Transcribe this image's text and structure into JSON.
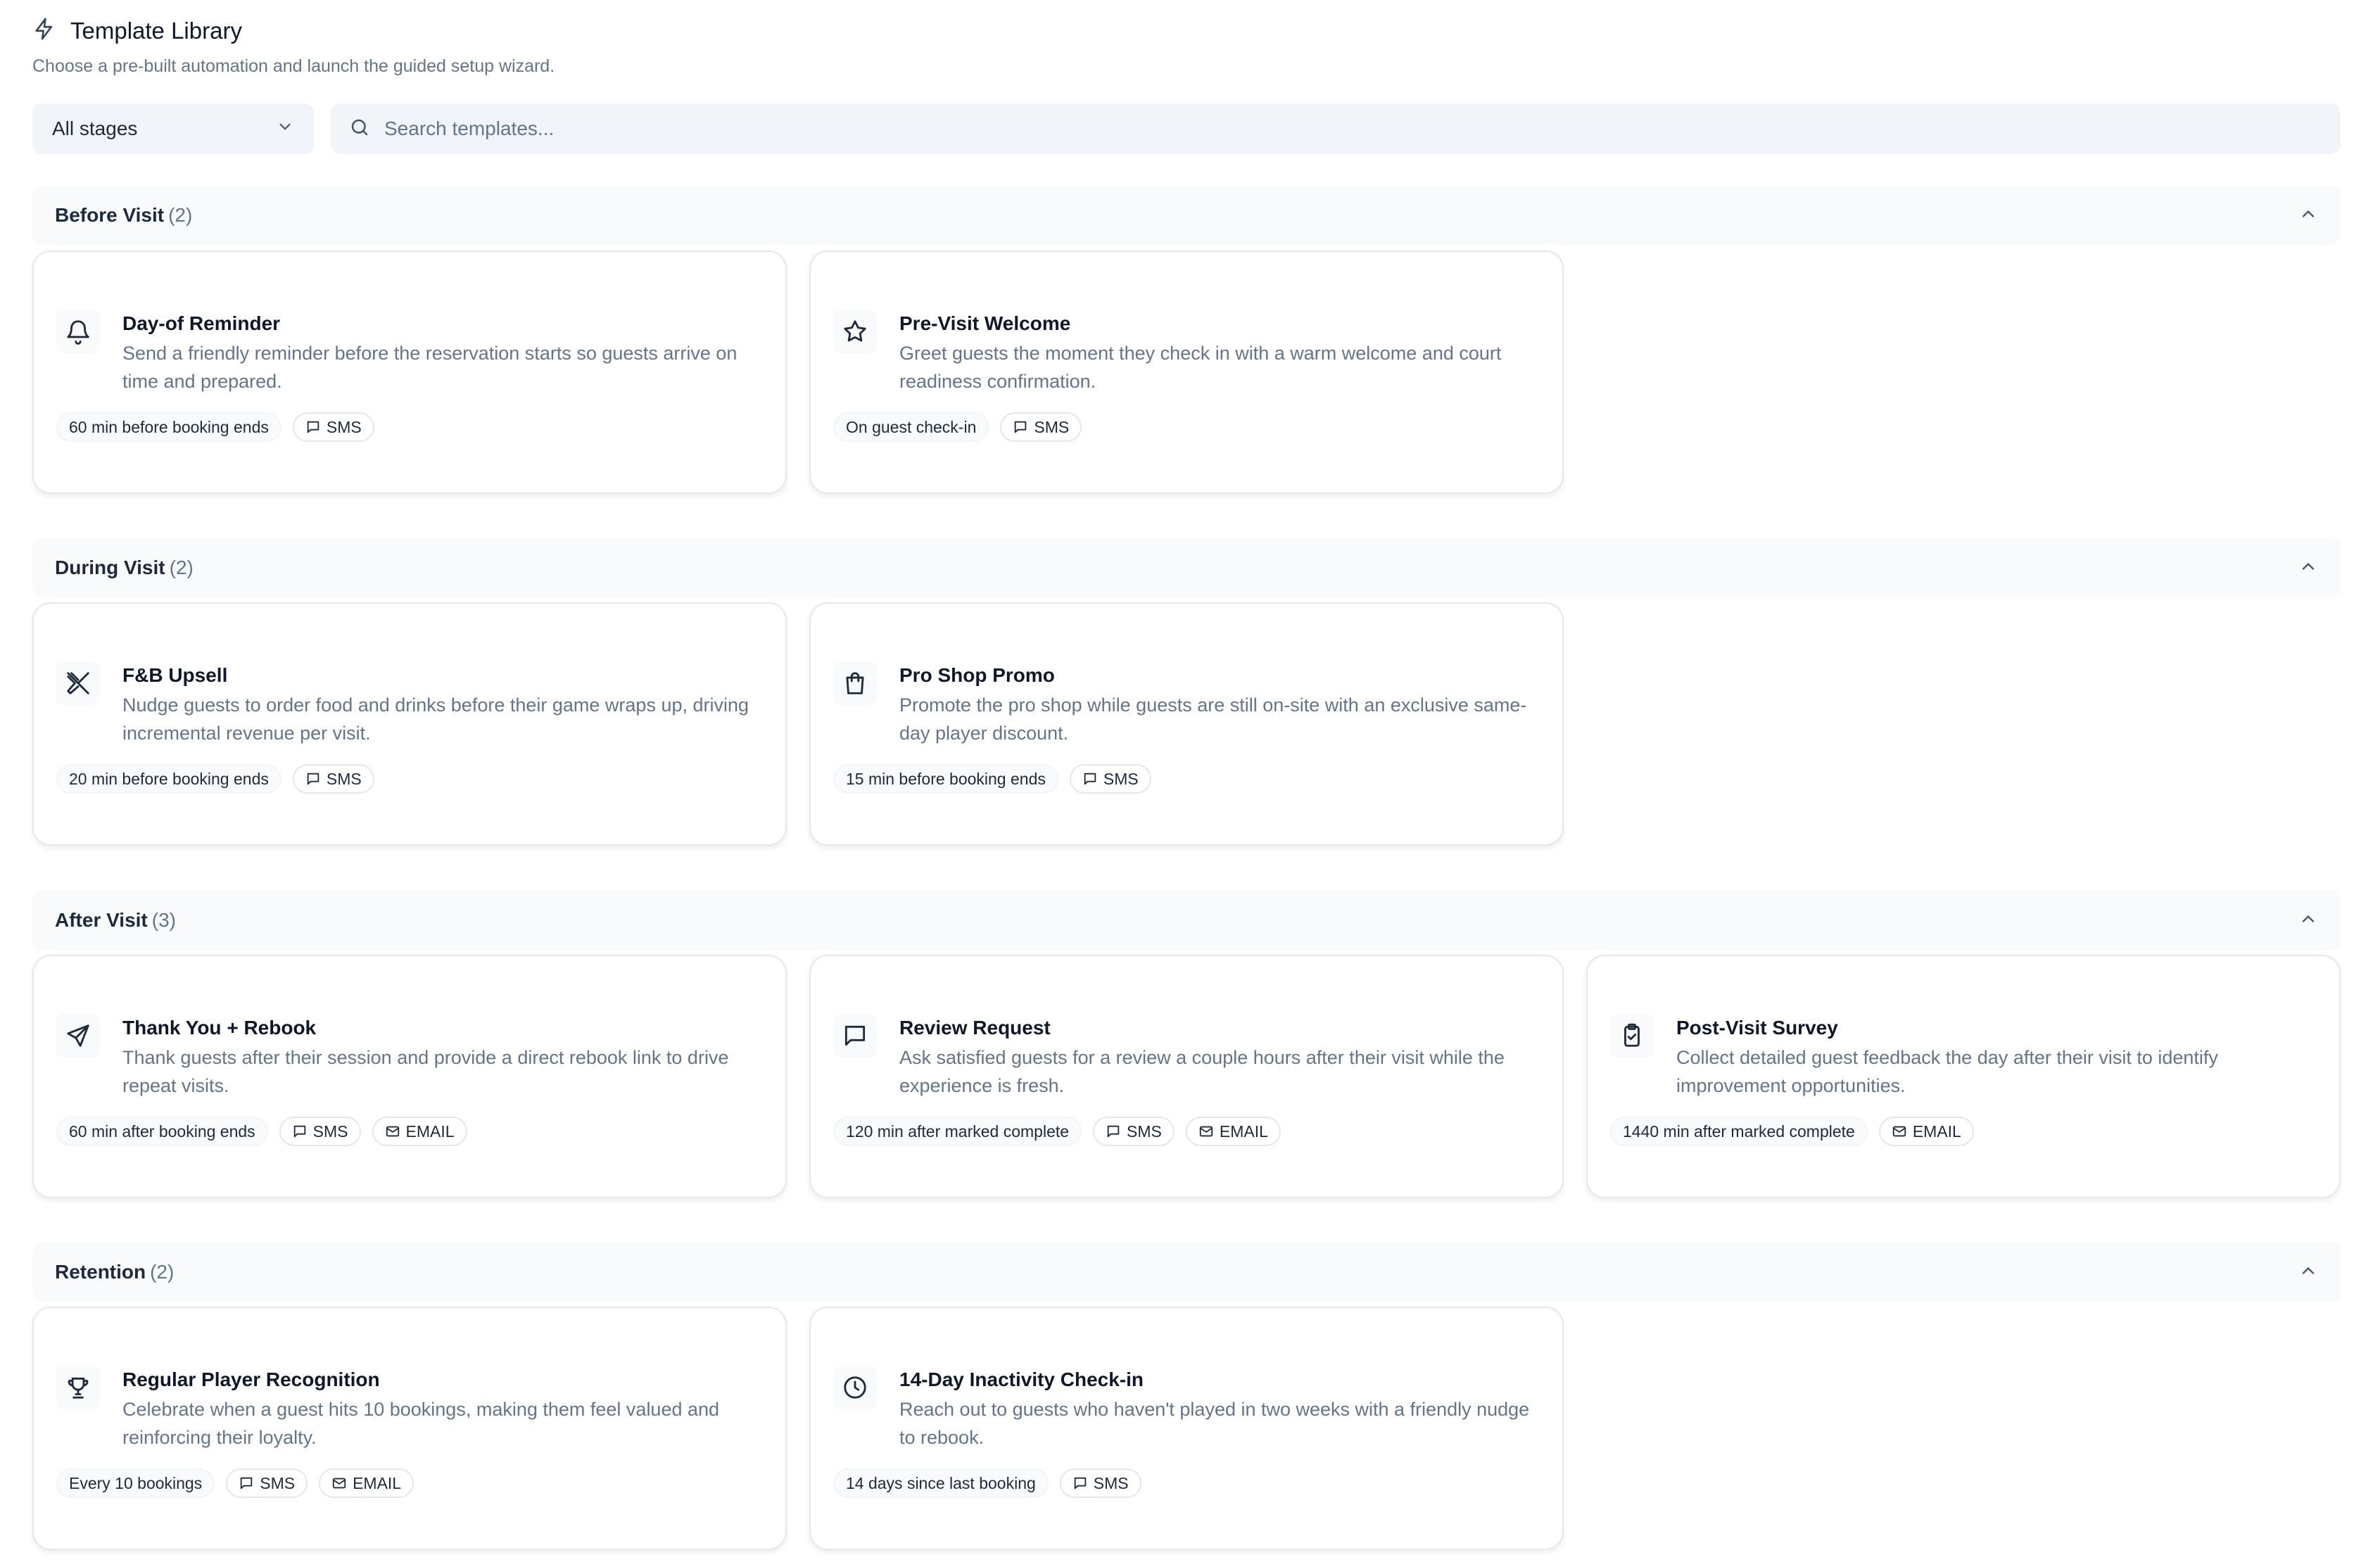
{
  "header": {
    "title": "Template Library",
    "subtitle": "Choose a pre-built automation and launch the guided setup wizard."
  },
  "filters": {
    "stage_selected": "All stages",
    "search_placeholder": "Search templates..."
  },
  "sections": [
    {
      "name": "Before Visit",
      "count": "(2)",
      "cards": [
        {
          "icon": "bell-icon",
          "title": "Day-of Reminder",
          "description": "Send a friendly reminder before the reservation starts so guests arrive on time and prepared.",
          "trigger": "60 min before booking ends",
          "channels": [
            "SMS"
          ]
        },
        {
          "icon": "star-icon",
          "title": "Pre-Visit Welcome",
          "description": "Greet guests the moment they check in with a warm welcome and court readiness confirmation.",
          "trigger": "On guest check-in",
          "channels": [
            "SMS"
          ]
        }
      ]
    },
    {
      "name": "During Visit",
      "count": "(2)",
      "cards": [
        {
          "icon": "utensils-crossed-icon",
          "title": "F&B Upsell",
          "description": "Nudge guests to order food and drinks before their game wraps up, driving incremental revenue per visit.",
          "trigger": "20 min before booking ends",
          "channels": [
            "SMS"
          ]
        },
        {
          "icon": "shopping-bag-icon",
          "title": "Pro Shop Promo",
          "description": "Promote the pro shop while guests are still on-site with an exclusive same-day player discount.",
          "trigger": "15 min before booking ends",
          "channels": [
            "SMS"
          ]
        }
      ]
    },
    {
      "name": "After Visit",
      "count": "(3)",
      "cards": [
        {
          "icon": "send-icon",
          "title": "Thank You + Rebook",
          "description": "Thank guests after their session and provide a direct rebook link to drive repeat visits.",
          "trigger": "60 min after booking ends",
          "channels": [
            "SMS",
            "EMAIL"
          ]
        },
        {
          "icon": "message-square-icon",
          "title": "Review Request",
          "description": "Ask satisfied guests for a review a couple hours after their visit while the experience is fresh.",
          "trigger": "120 min after marked complete",
          "channels": [
            "SMS",
            "EMAIL"
          ]
        },
        {
          "icon": "clipboard-check-icon",
          "title": "Post-Visit Survey",
          "description": "Collect detailed guest feedback the day after their visit to identify improvement opportunities.",
          "trigger": "1440 min after marked complete",
          "channels": [
            "EMAIL"
          ]
        }
      ]
    },
    {
      "name": "Retention",
      "count": "(2)",
      "cards": [
        {
          "icon": "trophy-icon",
          "title": "Regular Player Recognition",
          "description": "Celebrate when a guest hits 10 bookings, making them feel valued and reinforcing their loyalty.",
          "trigger": "Every 10 bookings",
          "channels": [
            "SMS",
            "EMAIL"
          ]
        },
        {
          "icon": "clock-icon",
          "title": "14-Day Inactivity Check-in",
          "description": "Reach out to guests who haven't played in two weeks with a friendly nudge to rebook.",
          "trigger": "14 days since last booking",
          "channels": [
            "SMS"
          ]
        }
      ]
    }
  ]
}
